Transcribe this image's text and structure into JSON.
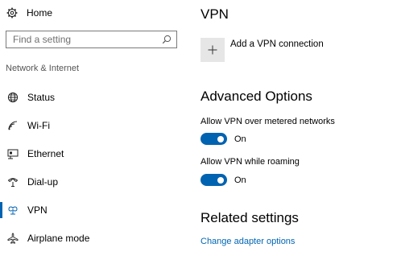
{
  "sidebar": {
    "home": {
      "label": "Home",
      "icon": "gear-icon"
    },
    "search": {
      "placeholder": "Find a setting",
      "value": "",
      "icon": "search-icon"
    },
    "section_label": "Network & Internet",
    "items": [
      {
        "label": "Status",
        "icon": "globe-icon",
        "active": false
      },
      {
        "label": "Wi-Fi",
        "icon": "wifi-icon",
        "active": false
      },
      {
        "label": "Ethernet",
        "icon": "ethernet-icon",
        "active": false
      },
      {
        "label": "Dial-up",
        "icon": "dialup-icon",
        "active": false
      },
      {
        "label": "VPN",
        "icon": "vpn-icon",
        "active": true
      },
      {
        "label": "Airplane mode",
        "icon": "airplane-icon",
        "active": false
      }
    ],
    "accent_color": "#0063b1"
  },
  "main": {
    "title": "VPN",
    "add_vpn": {
      "label": "Add a VPN connection",
      "icon": "plus-icon"
    },
    "advanced": {
      "heading": "Advanced Options",
      "options": [
        {
          "label": "Allow VPN over metered networks",
          "state": "On",
          "on": true
        },
        {
          "label": "Allow VPN while roaming",
          "state": "On",
          "on": true
        }
      ]
    },
    "related": {
      "heading": "Related settings",
      "link": "Change adapter options"
    },
    "link_color": "#0066b4"
  }
}
